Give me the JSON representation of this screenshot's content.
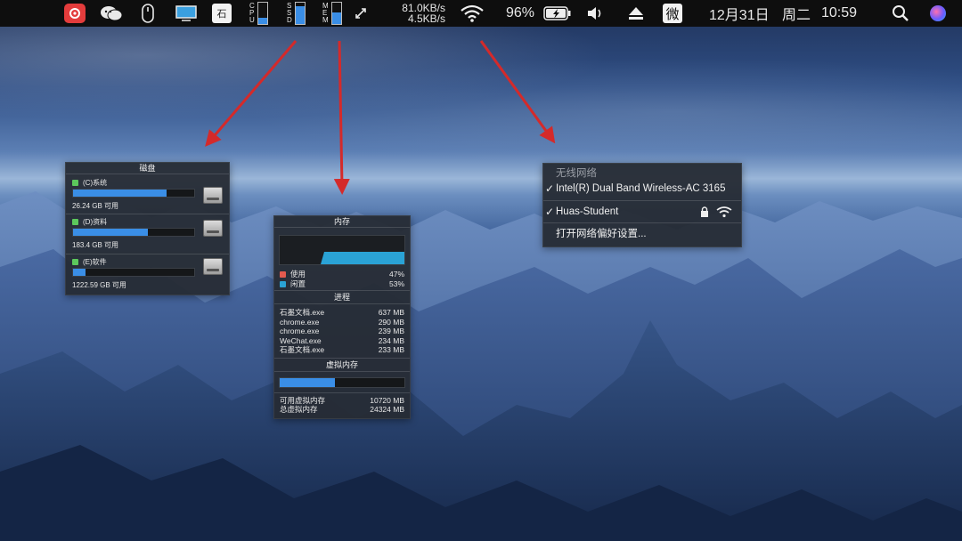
{
  "menubar": {
    "cpu_label": [
      "C",
      "P",
      "U"
    ],
    "ssd_label": [
      "S",
      "S",
      "D"
    ],
    "mem_label": [
      "M",
      "E",
      "M"
    ],
    "cpu_level": 0.3,
    "ssd_level": 0.85,
    "mem_level": 0.55,
    "net_up": "81.0KB/s",
    "net_down": "4.5KB/s",
    "battery_percent": "96%",
    "date": "12月31日",
    "weekday": "周二",
    "time": "10:59",
    "weibo_char": "微",
    "app_icon_char": "石"
  },
  "disk_panel": {
    "title": "磁盘",
    "drives": [
      {
        "label": "(C)系统",
        "free": "26.24 GB 可用",
        "used_fraction": 0.77,
        "color": "#5cc85c"
      },
      {
        "label": "(D)资料",
        "free": "183.4 GB 可用",
        "used_fraction": 0.62,
        "color": "#5cc85c"
      },
      {
        "label": "(E)软件",
        "free": "1222.59 GB 可用",
        "used_fraction": 0.1,
        "color": "#5cc85c"
      }
    ]
  },
  "memory_panel": {
    "title": "内存",
    "used_label": "使用",
    "used_percent": "47%",
    "idle_label": "闲置",
    "idle_percent": "53%",
    "used_color": "#e35a4f",
    "idle_color": "#2aa3d6",
    "process_title": "进程",
    "processes": [
      {
        "name": "石墨文档.exe",
        "mem": "637 MB"
      },
      {
        "name": "chrome.exe",
        "mem": "290 MB"
      },
      {
        "name": "chrome.exe",
        "mem": "239 MB"
      },
      {
        "name": "WeChat.exe",
        "mem": "234 MB"
      },
      {
        "name": "石墨文档.exe",
        "mem": "233 MB"
      }
    ],
    "virtual_title": "虚拟内存",
    "virtual_used_fraction": 0.44,
    "available_virtual_label": "可用虚拟内存",
    "available_virtual_value": "10720 MB",
    "total_virtual_label": "总虚拟内存",
    "total_virtual_value": "24324 MB"
  },
  "network_menu": {
    "section_title": "无线网络",
    "adapter": "Intel(R) Dual Band Wireless-AC 3165",
    "network": "Huas-Student",
    "prefs": "打开网络偏好设置..."
  },
  "colors": {
    "accent": "#3a8ee6",
    "arrow": "#d42a2a",
    "menubar": "#0e0e0e"
  }
}
